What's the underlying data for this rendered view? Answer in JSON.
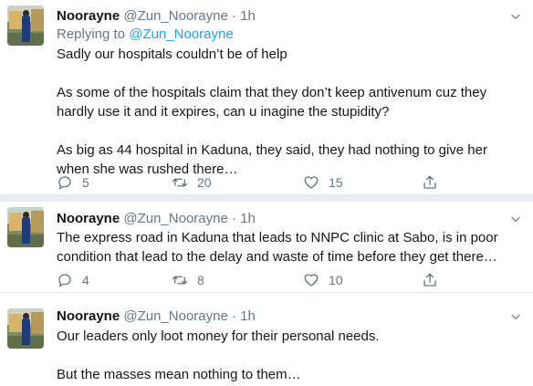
{
  "tweets": [
    {
      "name": "Noorayne",
      "handle": "@Zun_Noorayne",
      "dot": "·",
      "time": "1h",
      "reply_prefix": "Replying to",
      "reply_to": "@Zun_Noorayne",
      "paragraphs": [
        "Sadly our hospitals couldn’t be of help",
        "As some of the hospitals claim that they don’t keep antivenum cuz they hardly use it and it expires, can u inagine the stupidity?",
        "As big as 44 hospital in Kaduna, they said, they had nothing to give her when she was rushed there…"
      ],
      "replies": "5",
      "retweets": "20",
      "likes": "15"
    },
    {
      "name": "Noorayne",
      "handle": "@Zun_Noorayne",
      "dot": "·",
      "time": "1h",
      "paragraphs": [
        "The express road in Kaduna that leads to NNPC clinic at Sabo, is in poor condition that lead to the delay and waste of time before they get there…"
      ],
      "replies": "4",
      "retweets": "8",
      "likes": "10"
    },
    {
      "name": "Noorayne",
      "handle": "@Zun_Noorayne",
      "dot": "·",
      "time": "1h",
      "paragraphs": [
        "Our leaders only loot money for their personal needs.",
        "But the masses mean nothing to them…"
      ]
    }
  ],
  "icons": {
    "more": "chevron-down-icon",
    "reply": "reply-icon",
    "retweet": "retweet-icon",
    "like": "heart-icon",
    "share": "share-icon"
  },
  "colors": {
    "text": "#14171a",
    "muted": "#657786",
    "link": "#1da1f2",
    "divider": "#e6ecf0"
  }
}
